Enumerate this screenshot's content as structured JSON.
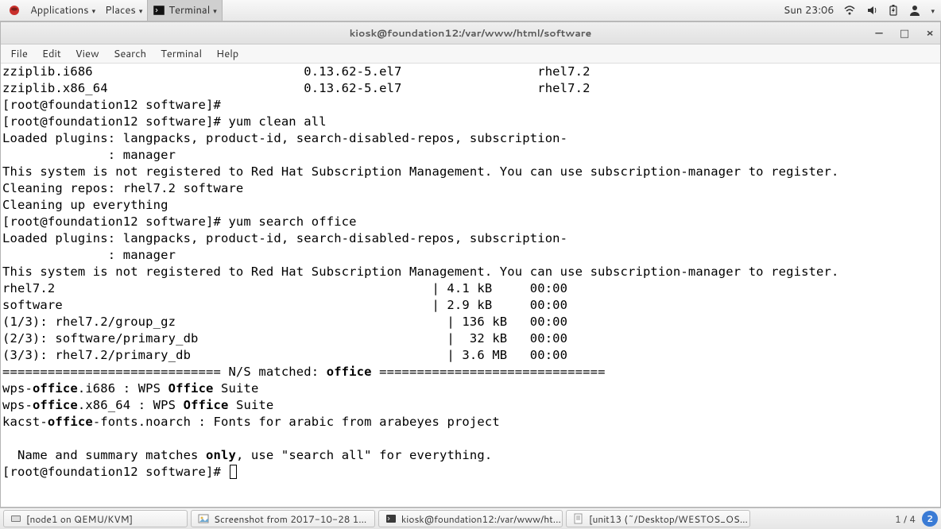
{
  "top_panel": {
    "applications": "Applications",
    "places": "Places",
    "terminal": "Terminal",
    "clock": "Sun 23:06"
  },
  "window": {
    "title": "kiosk@foundation12:/var/www/html/software",
    "menus": {
      "file": "File",
      "edit": "Edit",
      "view": "View",
      "search": "Search",
      "terminal": "Terminal",
      "help": "Help"
    }
  },
  "terminal_lines": {
    "l0": "zziplib.i686                            0.13.62-5.el7                  rhel7.2",
    "l1": "zziplib.x86_64                          0.13.62-5.el7                  rhel7.2",
    "l2": "[root@foundation12 software]#",
    "l3": "[root@foundation12 software]# yum clean all",
    "l4": "Loaded plugins: langpacks, product-id, search-disabled-repos, subscription-",
    "l5": "              : manager",
    "l6": "This system is not registered to Red Hat Subscription Management. You can use subscription-manager to register.",
    "l7": "Cleaning repos: rhel7.2 software",
    "l8": "Cleaning up everything",
    "l9": "[root@foundation12 software]# yum search office",
    "l10": "Loaded plugins: langpacks, product-id, search-disabled-repos, subscription-",
    "l11": "              : manager",
    "l12": "This system is not registered to Red Hat Subscription Management. You can use subscription-manager to register.",
    "l13": "rhel7.2                                                  | 4.1 kB     00:00",
    "l14": "software                                                 | 2.9 kB     00:00",
    "l15": "(1/3): rhel7.2/group_gz                                    | 136 kB   00:00",
    "l16": "(2/3): software/primary_db                                 |  32 kB   00:00",
    "l17": "(3/3): rhel7.2/primary_db                                  | 3.6 MB   00:00",
    "l18a": "============================= N/S matched: ",
    "l18b": "office",
    "l18c": " ==============================",
    "l19a": "wps-",
    "l19b": "office",
    "l19c": ".i686 : WPS ",
    "l19d": "Office",
    "l19e": " Suite",
    "l20a": "wps-",
    "l20b": "office",
    "l20c": ".x86_64 : WPS ",
    "l20d": "Office",
    "l20e": " Suite",
    "l21a": "kacst-",
    "l21b": "office",
    "l21c": "-fonts.noarch : Fonts for arabic from arabeyes project",
    "l22": "",
    "l23a": "  Name and summary matches ",
    "l23b": "only",
    "l23c": ", use \"search all\" for everything.",
    "l24": "[root@foundation12 software]# "
  },
  "taskbar": {
    "b0": "[node1 on QEMU/KVM]",
    "b1": "Screenshot from 2017-10-28 1...",
    "b2": "kiosk@foundation12:/var/www/ht...",
    "b3": "[unit13 (~/Desktop/WESTOS_OS...",
    "ws_count": "1 / 4",
    "ws_badge": "2"
  }
}
